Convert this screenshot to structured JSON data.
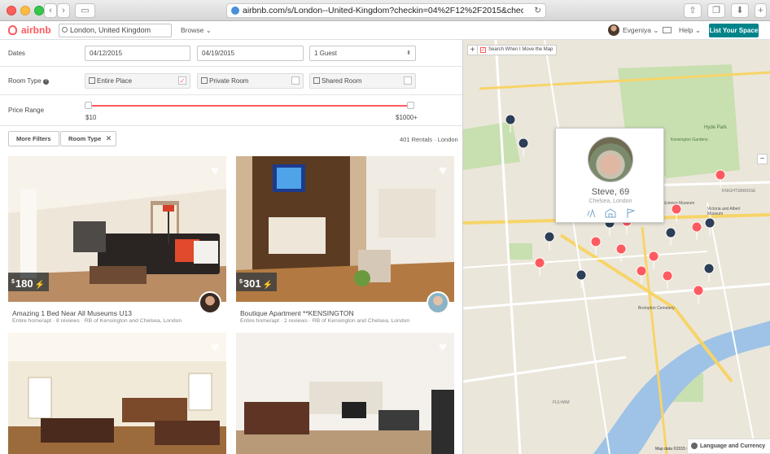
{
  "browser": {
    "url": "airbnb.com/s/London--United-Kingdom?checkin=04%2F12%2F2015&checkout=04%2F19%"
  },
  "header": {
    "logo": "airbnb",
    "search_value": "London, United Kingdom",
    "browse": "Browse",
    "user_name": "Evgeniya",
    "help": "Help",
    "list_space": "List Your Space"
  },
  "filters": {
    "dates_label": "Dates",
    "checkin": "04/12/2015",
    "checkout": "04/19/2015",
    "guests": "1 Guest",
    "room_type_label": "Room Type",
    "room_types": [
      {
        "label": "Entire Place",
        "checked": true
      },
      {
        "label": "Private Room",
        "checked": false
      },
      {
        "label": "Shared Room",
        "checked": false
      }
    ],
    "price_label": "Price Range",
    "price_min": "$10",
    "price_max": "$1000+",
    "more_filters": "More Filters",
    "room_type_chip": "Room Type",
    "results_count": "401 Rentals · London"
  },
  "listings": [
    {
      "price_currency": "$",
      "price": "180",
      "title": "Amazing 1 Bed Near All Museums U13",
      "subtitle": "Entire home/apt · 8 reviews · RB of Kensington and Chelsea, London"
    },
    {
      "price_currency": "$",
      "price": "301",
      "title": "Boutique Apartment **KENSINGTON",
      "subtitle": "Entire home/apt · 2 reviews · RB of Kensington and Chelsea, London"
    },
    {
      "price_currency": "",
      "price": "",
      "title": "",
      "subtitle": ""
    },
    {
      "price_currency": "",
      "price": "",
      "title": "",
      "subtitle": ""
    }
  ],
  "map": {
    "search_toggle": "Search When I Move the Map",
    "zoom_in": "+",
    "zoom_out": "−",
    "popup_name": "Steve, 69",
    "popup_location": "Chelsea, London",
    "language_currency": "Language and Currency",
    "copyright": "Map data ©2015 Google",
    "labels": [
      "KNIGHTSBRIDGE",
      "Science Museum",
      "Victoria and Albert Museum",
      "Hyde Park",
      "Kensington Gardens",
      "Brompton Cemetery",
      "FULHAM"
    ],
    "water_color": "#9ec3e6",
    "park_color": "#c8dfb0"
  },
  "colors": {
    "brand": "#ff5a5f",
    "teal": "#00848a",
    "superhost_bolt": "#ffb400"
  }
}
